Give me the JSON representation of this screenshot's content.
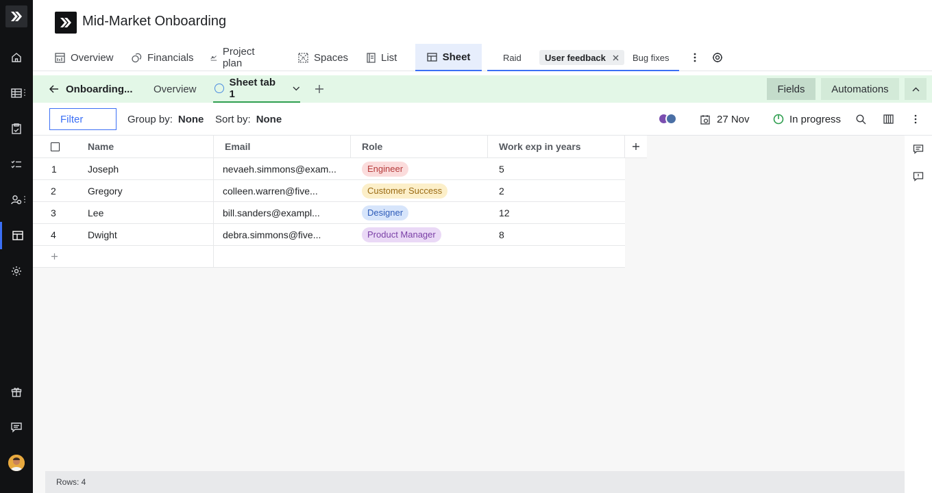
{
  "project": {
    "title": "Mid-Market Onboarding"
  },
  "tabs": [
    {
      "label": "Overview",
      "icon": "dashboard-icon"
    },
    {
      "label": "Financials",
      "icon": "coins-icon"
    },
    {
      "label": "Project plan",
      "icon": "gantt-icon"
    },
    {
      "label": "Spaces",
      "icon": "spaces-icon"
    },
    {
      "label": "List",
      "icon": "list-icon"
    },
    {
      "label": "Sheet",
      "icon": "table-icon",
      "active": true
    }
  ],
  "subtabs": {
    "raid": "Raid",
    "user_feedback": "User feedback",
    "bug_fixes": "Bug fixes"
  },
  "sheetbar": {
    "back_label": "Onboarding...",
    "overview_label": "Overview",
    "sheet_tab_label": "Sheet tab 1",
    "fields_label": "Fields",
    "automations_label": "Automations"
  },
  "toolbar": {
    "filter_label": "Filter",
    "group_by_label": "Group by:",
    "group_by_value": "None",
    "sort_by_label": "Sort by:",
    "sort_by_value": "None",
    "date": "27 Nov",
    "status": "In progress"
  },
  "table": {
    "columns": [
      "Name",
      "Email",
      "Role",
      "Work exp in years"
    ],
    "rows": [
      {
        "num": "1",
        "name": "Joseph",
        "email": "nevaeh.simmons@exam...",
        "role": "Engineer",
        "exp": "5"
      },
      {
        "num": "2",
        "name": "Gregory",
        "email": "colleen.warren@five...",
        "role": "Customer Success",
        "exp": "2"
      },
      {
        "num": "3",
        "name": "Lee",
        "email": "bill.sanders@exampl...",
        "role": "Designer",
        "exp": "12"
      },
      {
        "num": "4",
        "name": "Dwight",
        "email": "debra.simmons@five...",
        "role": "Product Manager",
        "exp": "8"
      }
    ]
  },
  "role_colors": {
    "Engineer": {
      "bg": "#fbdcdc",
      "fg": "#b53a3a"
    },
    "Customer Success": {
      "bg": "#fcefc9",
      "fg": "#9a6a12"
    },
    "Designer": {
      "bg": "#d7e5fb",
      "fg": "#2d5bb8"
    },
    "Product Manager": {
      "bg": "#ead9f6",
      "fg": "#7a3fa6"
    }
  },
  "footer": {
    "rows_label": "Rows: 4"
  },
  "colors": {
    "accent": "#3b6ff5",
    "sheet_bar": "#e3f7e7",
    "status_green": "#2e9e4f"
  }
}
